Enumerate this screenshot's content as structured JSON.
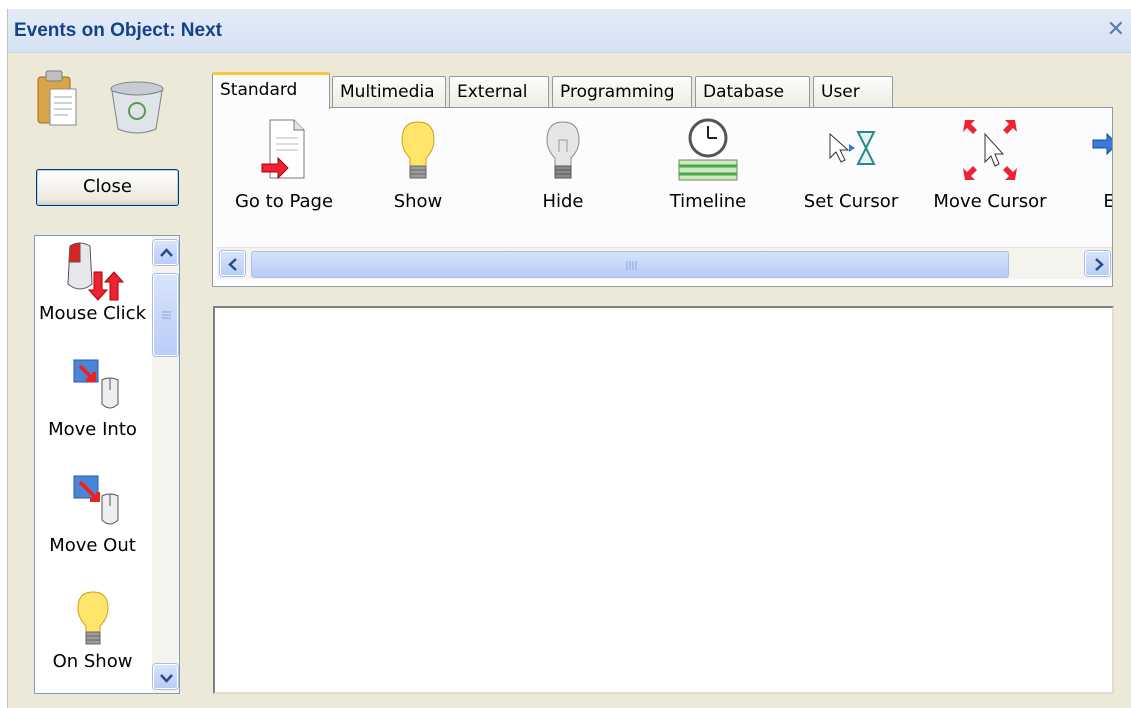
{
  "window": {
    "title": "Events on Object: Next"
  },
  "toolbar": {
    "paste_icon": "clipboard-icon",
    "delete_icon": "recycle-bin-icon"
  },
  "close_button": {
    "label": "Close"
  },
  "events": [
    {
      "label": "Mouse Click",
      "icon": "mouse-click-icon"
    },
    {
      "label": "Move Into",
      "icon": "move-into-icon"
    },
    {
      "label": "Move Out",
      "icon": "move-out-icon"
    },
    {
      "label": "On Show",
      "icon": "lightbulb-on-icon"
    }
  ],
  "tabs": [
    {
      "label": "Standard",
      "active": true
    },
    {
      "label": "Multimedia",
      "active": false
    },
    {
      "label": "External",
      "active": false
    },
    {
      "label": "Programming",
      "active": false
    },
    {
      "label": "Database",
      "active": false
    },
    {
      "label": "User",
      "active": false
    }
  ],
  "actions": [
    {
      "label": "Go to Page",
      "icon": "document-arrow-icon"
    },
    {
      "label": "Show",
      "icon": "lightbulb-on-icon"
    },
    {
      "label": "Hide",
      "icon": "lightbulb-off-icon"
    },
    {
      "label": "Timeline",
      "icon": "timeline-clock-icon"
    },
    {
      "label": "Set Cursor",
      "icon": "cursor-hourglass-icon"
    },
    {
      "label": "Move Cursor",
      "icon": "move-cursor-icon"
    },
    {
      "label": "E",
      "icon": "arrow-right-icon"
    }
  ],
  "colors": {
    "title": "#15428b",
    "panel": "#ece9d8",
    "active_tab_accent": "#ffc83c"
  }
}
